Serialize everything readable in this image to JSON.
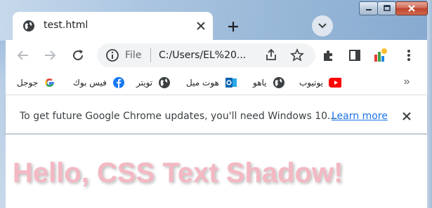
{
  "window": {
    "caption_icons": [
      "minimize-icon",
      "maximize-icon",
      "close-icon"
    ]
  },
  "tab": {
    "title": "test.html",
    "favicon": "globe-icon"
  },
  "toolbar": {
    "omnibox": {
      "scheme_label": "File",
      "url": "C:/Users/EL%20..."
    }
  },
  "bookmarks": [
    {
      "label": "جوجل",
      "icon": "google-icon",
      "color": "#4285f4"
    },
    {
      "label": "فيس بوك",
      "icon": "facebook-icon",
      "color": "#1877f2"
    },
    {
      "label": "تويتر",
      "icon": "globe-icon",
      "color": "#5f6368"
    },
    {
      "label": "هوت ميل",
      "icon": "outlook-icon",
      "color": "#0a64ad"
    },
    {
      "label": "ياهو",
      "icon": "globe-icon",
      "color": "#5f6368"
    },
    {
      "label": "يوتيوب",
      "icon": "youtube-icon",
      "color": "#ff0000"
    }
  ],
  "infobar": {
    "message": "To get future Google Chrome updates, you'll need Windows 10...",
    "link": "Learn more"
  },
  "page": {
    "heading": "Hello, CSS Text Shadow!",
    "heading_color": "#f4b8c3"
  }
}
